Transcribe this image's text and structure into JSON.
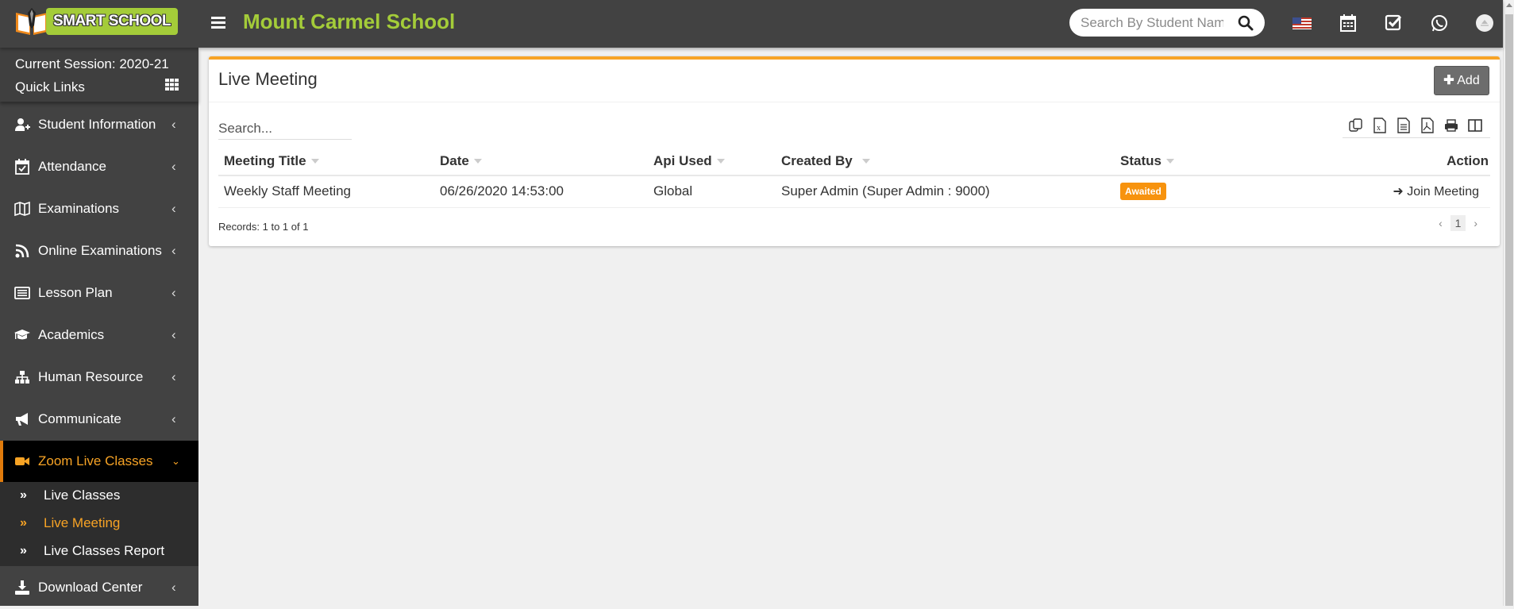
{
  "header": {
    "logo_text": "SMART SCHOOL",
    "school_name": "Mount Carmel School",
    "search_placeholder": "Search By Student Name",
    "icons": [
      "menu-icon",
      "search-icon",
      "us-flag-icon",
      "calendar-icon",
      "check-square-icon",
      "whatsapp-icon",
      "user-avatar-icon"
    ]
  },
  "sidebar": {
    "session_label": "Current Session: 2020-21",
    "quick_links": "Quick Links",
    "items": [
      {
        "label": "Student Information",
        "icon": "user-plus-icon"
      },
      {
        "label": "Attendance",
        "icon": "calendar-check-icon"
      },
      {
        "label": "Examinations",
        "icon": "map-icon"
      },
      {
        "label": "Online Examinations",
        "icon": "rss-icon"
      },
      {
        "label": "Lesson Plan",
        "icon": "list-alt-icon"
      },
      {
        "label": "Academics",
        "icon": "graduation-cap-icon"
      },
      {
        "label": "Human Resource",
        "icon": "sitemap-icon"
      },
      {
        "label": "Communicate",
        "icon": "bullhorn-icon"
      },
      {
        "label": "Zoom Live Classes",
        "icon": "video-camera-icon",
        "active": true
      },
      {
        "label": "Download Center",
        "icon": "download-icon"
      }
    ],
    "submenu": [
      {
        "label": "Live Classes"
      },
      {
        "label": "Live Meeting",
        "active": true
      },
      {
        "label": "Live Classes Report"
      }
    ]
  },
  "main": {
    "title": "Live Meeting",
    "add_label": "Add",
    "search_placeholder": "Search...",
    "export_icons": [
      "copy-icon",
      "excel-icon",
      "csv-icon",
      "pdf-icon",
      "print-icon",
      "columns-icon"
    ],
    "columns": [
      "Meeting Title",
      "Date",
      "Api Used",
      "Created By",
      "Status",
      "Action"
    ],
    "rows": [
      {
        "meeting_title": "Weekly Staff Meeting",
        "date": "06/26/2020 14:53:00",
        "api_used": "Global",
        "created_by": "Super Admin (Super Admin : 9000)",
        "status": "Awaited",
        "action": "Join Meeting"
      }
    ],
    "records": "Records: 1 to 1 of 1",
    "pager": {
      "prev": "‹",
      "current": "1",
      "next": "›"
    }
  },
  "colors": {
    "accent_orange": "#f7a325",
    "brand_green": "#a4cc39",
    "header_bg": "#424242",
    "status_awaited": "#f7930e"
  }
}
